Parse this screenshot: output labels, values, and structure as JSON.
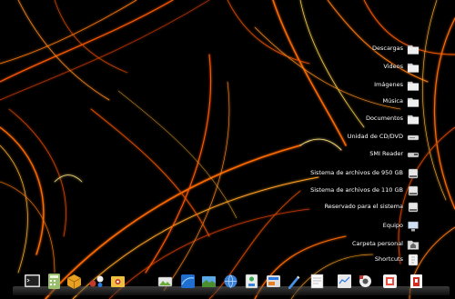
{
  "desktop": {
    "icons": [
      {
        "label": "Descargas",
        "icon": "folder-icon"
      },
      {
        "label": "Videos",
        "icon": "folder-icon"
      },
      {
        "label": "Imágenes",
        "icon": "folder-icon"
      },
      {
        "label": "Música",
        "icon": "folder-icon"
      },
      {
        "label": "Documentos",
        "icon": "folder-icon"
      },
      {
        "label": "Unidad de CD/DVD",
        "icon": "optical-drive-icon"
      },
      {
        "label": "SMI Reader",
        "icon": "card-reader-icon"
      },
      {
        "label": "Sistema de archivos de 950 GB",
        "icon": "hard-drive-icon"
      },
      {
        "label": "Sistema de archivos de 110 GB",
        "icon": "hard-drive-icon"
      },
      {
        "label": "Reservado para el sistema",
        "icon": "hard-drive-icon"
      },
      {
        "label": "Equipo",
        "icon": "computer-icon"
      },
      {
        "label": "Carpeta personal",
        "icon": "home-folder-icon"
      },
      {
        "label": "Shortcuts",
        "icon": "shortcuts-icon"
      }
    ]
  },
  "dock": {
    "items": [
      {
        "name": "terminal-icon"
      },
      {
        "name": "calculator-icon"
      },
      {
        "name": "package-manager-icon"
      },
      {
        "name": "games-icon"
      },
      {
        "name": "image-viewer-icon"
      },
      {
        "name": "photo-manager-icon"
      },
      {
        "name": "media-player-icon"
      },
      {
        "name": "network-icon"
      },
      {
        "name": "browser-icon"
      },
      {
        "name": "file-manager-icon"
      },
      {
        "name": "messenger-icon"
      },
      {
        "name": "text-editor-icon"
      },
      {
        "name": "notes-icon"
      },
      {
        "name": "system-monitor-icon"
      },
      {
        "name": "settings-icon"
      },
      {
        "name": "office-icon"
      },
      {
        "name": "trash-icon"
      }
    ]
  },
  "colors": {
    "background": "#000000",
    "fractal_orange": "#ff6a00",
    "fractal_yellow": "#ffd24a",
    "label_text": "#ffffff"
  }
}
